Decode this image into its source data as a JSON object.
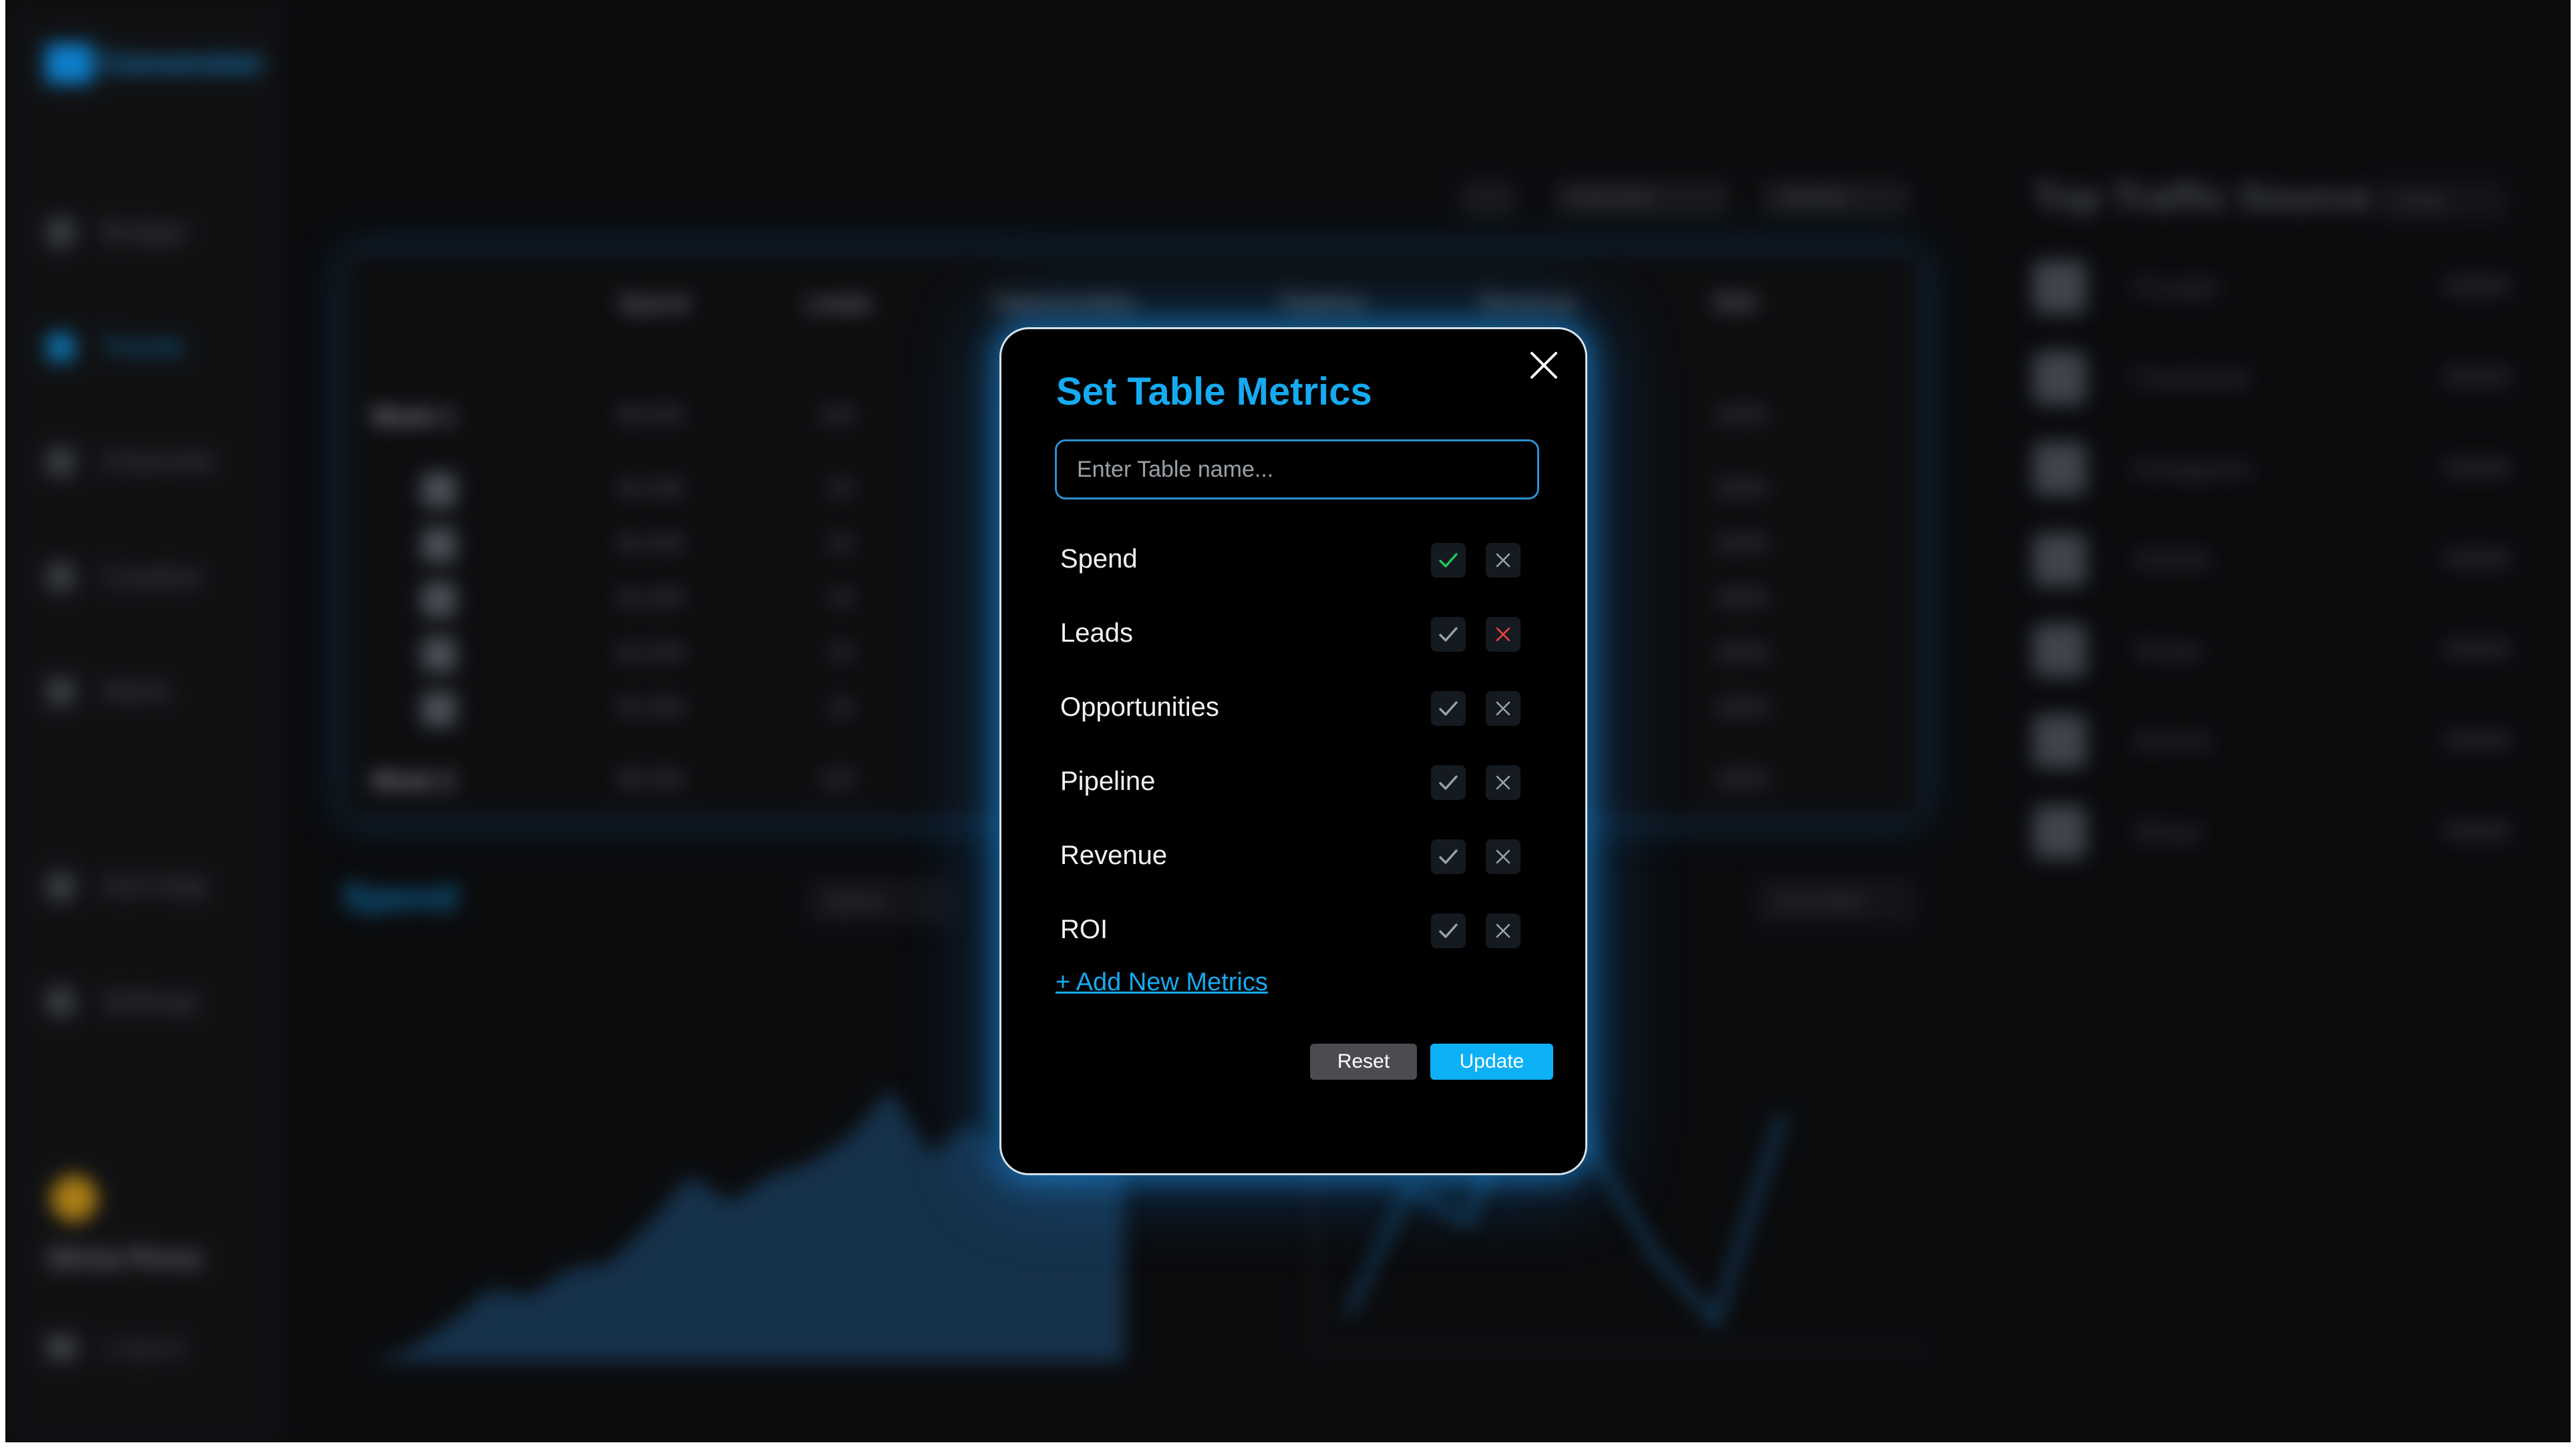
{
  "background": {
    "app_name": "Conversion",
    "nav": [
      "Budget",
      "Trends",
      "Channels",
      "Creative",
      "Alerts",
      "Get Help",
      "Settings"
    ],
    "user_name": "Silvia Perez",
    "logout_label": "Logout",
    "toolbar": {
      "toggle_label": "Channels",
      "period": "Weekly"
    },
    "table": {
      "columns": [
        "Spend",
        "Leads",
        "Opportunities",
        "Pipeline",
        "Revenue",
        "ROI"
      ],
      "rows": [
        {
          "label": "Week 1",
          "spend": "$5,000",
          "leads": "100",
          "roi": "150%"
        },
        {
          "label": "Week 2",
          "spend": "$5,000",
          "leads": "100",
          "roi": "150%"
        }
      ],
      "sub_rows": [
        {
          "spend": "$1,000",
          "leads": "20",
          "roi": "150%"
        },
        {
          "spend": "$1,000",
          "leads": "20",
          "roi": "150%"
        },
        {
          "spend": "$1,000",
          "leads": "20",
          "roi": "150%"
        },
        {
          "spend": "$1,000",
          "leads": "20",
          "roi": "150%"
        },
        {
          "spend": "$1,000",
          "leads": "20",
          "roi": "150%"
        }
      ]
    },
    "spend_heading": "Spend",
    "spend_dropdown": "Spend",
    "chart_dropdown": "Line Chart",
    "traffic": {
      "title": "Top Traffic Source",
      "dropdown": "Leads",
      "sources": [
        "Google",
        "Facebook",
        "Instagram",
        "Airbnb",
        "Stripe",
        "Airbnb",
        "Stripe"
      ]
    }
  },
  "modal": {
    "title": "Set Table Metrics",
    "name_placeholder": "Enter Table name...",
    "metrics": [
      {
        "label": "Spend",
        "state": "included"
      },
      {
        "label": "Leads",
        "state": "excluded"
      },
      {
        "label": "Opportunities",
        "state": "none"
      },
      {
        "label": "Pipeline",
        "state": "none"
      },
      {
        "label": "Revenue",
        "state": "none"
      },
      {
        "label": "ROI",
        "state": "none"
      }
    ],
    "add_link": "+ Add New Metrics",
    "reset_label": "Reset",
    "update_label": "Update",
    "colors": {
      "accent": "#16aaf0",
      "check_active": "#22c55e",
      "cross_active": "#ef4444",
      "icon_idle": "#9aa3ab"
    }
  }
}
